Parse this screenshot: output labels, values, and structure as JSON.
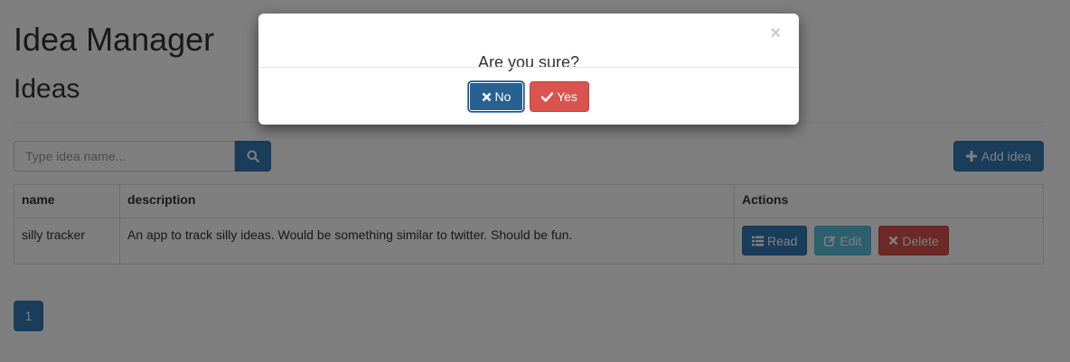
{
  "app": {
    "title": "Idea Manager"
  },
  "section": {
    "title": "Ideas"
  },
  "search": {
    "placeholder": "Type idea name...",
    "icon": "search-icon"
  },
  "toolbar": {
    "add_label": "Add idea",
    "add_icon": "plus-icon"
  },
  "table": {
    "headers": [
      "name",
      "description",
      "Actions"
    ],
    "rows": [
      {
        "name": "silly tracker",
        "description": "An app to track silly ideas. Would be something similar to twitter. Should be fun.",
        "actions": {
          "read": "Read",
          "edit": "Edit",
          "delete": "Delete"
        }
      }
    ]
  },
  "pagination": {
    "current": "1"
  },
  "modal": {
    "title": "Are you sure?",
    "close": "×",
    "no_label": "No",
    "yes_label": "Yes"
  },
  "colors": {
    "primary": "#337ab7",
    "info": "#5bc0de",
    "danger": "#d9534f",
    "backdrop": "rgba(0,0,0,0.5)"
  }
}
